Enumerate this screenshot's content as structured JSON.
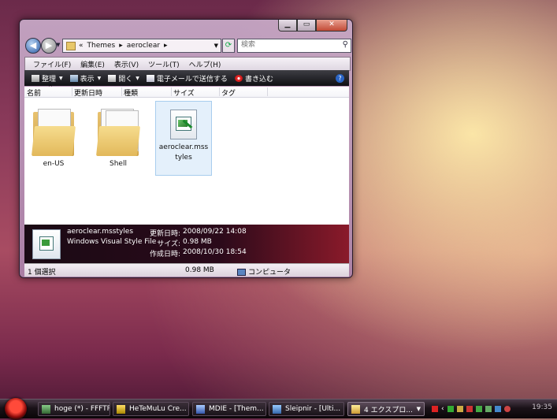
{
  "window": {
    "address": {
      "chevron": "«",
      "crumb1": "Themes",
      "sep": "▸",
      "crumb2": "aeroclear"
    },
    "search_placeholder": "検索",
    "menu": [
      "ファイル(F)",
      "編集(E)",
      "表示(V)",
      "ツール(T)",
      "ヘルプ(H)"
    ],
    "toolbar": {
      "organize": "整理",
      "view": "表示",
      "open": "開く",
      "email": "電子メールで送信する",
      "burn": "書き込む"
    },
    "columns": {
      "name": "名前",
      "date": "更新日時",
      "type": "種類",
      "size": "サイズ",
      "tag": "タグ"
    },
    "items": [
      {
        "label": "en-US",
        "kind": "folder"
      },
      {
        "label": "Shell",
        "kind": "folder"
      },
      {
        "label": "aeroclear.msstyles",
        "kind": "msstyles",
        "selected": true
      }
    ],
    "details": {
      "filename": "aeroclear.msstyles",
      "filetype": "Windows Visual Style File",
      "modified_label": "更新日時:",
      "modified_value": "2008/09/22 14:08",
      "size_label": "サイズ:",
      "size_value": "0.98 MB",
      "created_label": "作成日時:",
      "created_value": "2008/10/30 18:54"
    },
    "status": {
      "selection": "1 個選択",
      "size": "0.98 MB",
      "location": "コンピュータ"
    }
  },
  "taskbar": {
    "tasks": [
      {
        "label": "hoge (*) - FFFTP"
      },
      {
        "label": "HeTeMuLu Cre..."
      },
      {
        "label": "MDIE - [Them..."
      },
      {
        "label": "Sleipnir - [Ulti..."
      },
      {
        "label": "4 エクスプロ...",
        "active": true
      }
    ],
    "clock": "19:35"
  },
  "colors": {
    "taskbar_bg": "#1a1218",
    "toolbar_bg": "#1e1e22",
    "details_accent": "#8a1a2a"
  }
}
